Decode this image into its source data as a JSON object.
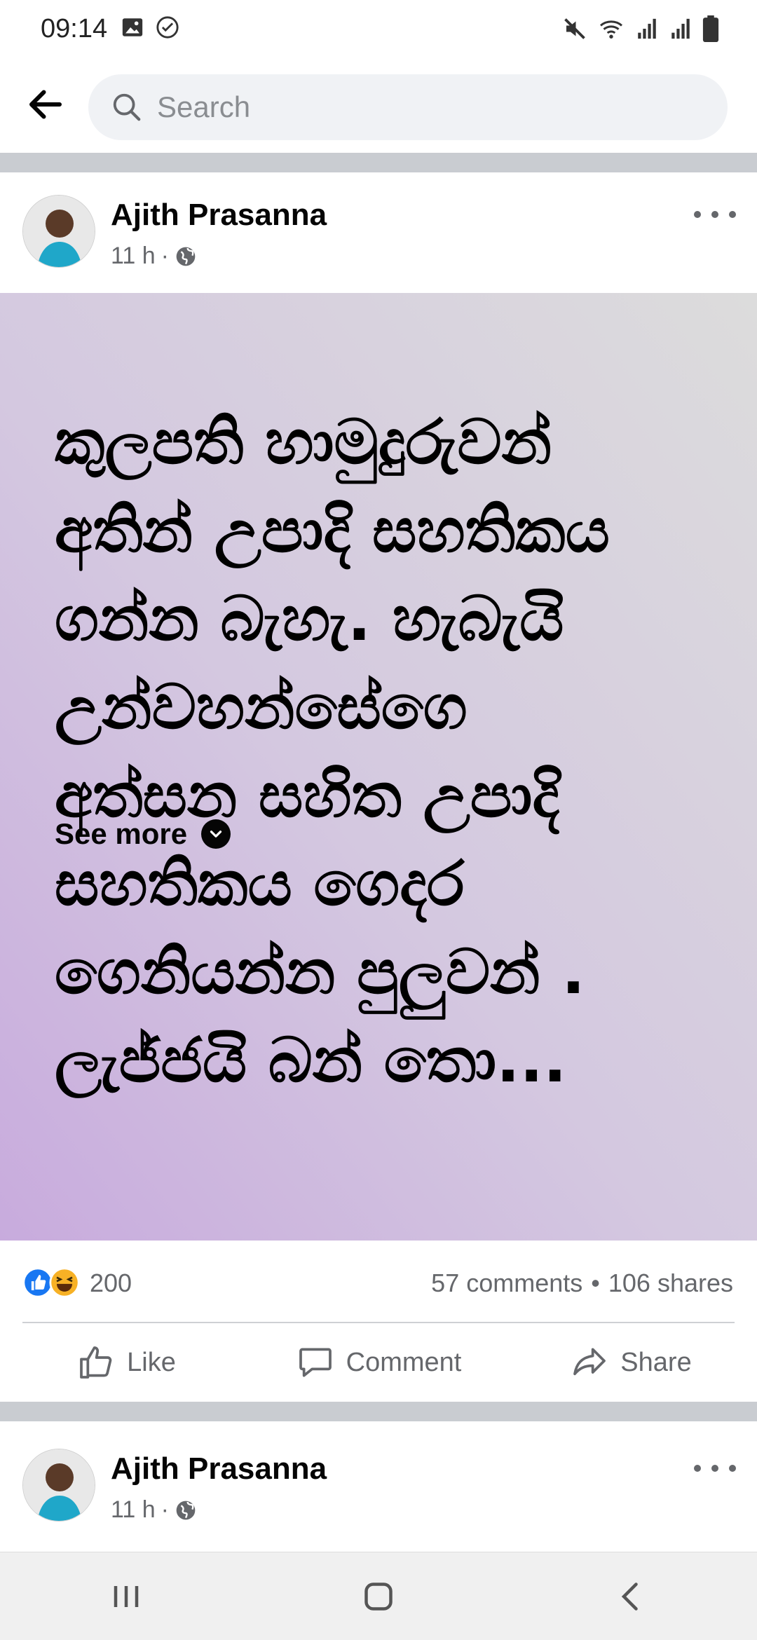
{
  "status_bar": {
    "time": "09:14",
    "icons_left": [
      "gallery-icon",
      "check-circle-icon"
    ],
    "icons_right": [
      "mute-icon",
      "wifi-icon",
      "signal-icon",
      "signal-icon",
      "battery-icon"
    ]
  },
  "search": {
    "placeholder": "Search"
  },
  "post": {
    "author": "Ajith Prasanna",
    "time": "11 h",
    "separator": "·",
    "audience_icon": "globe-icon",
    "text_lines": [
      "කුලපති හාමුදුරුවන්",
      "අතින් උපාදි සහතිකය",
      "ගන්න බැහැ. හැබැයි",
      "උන්වහන්සේගෙ",
      "අත්සන සහිත උපාදි",
      "සහතිකය ගෙදර",
      "ගෙනියන්න පුලුවන් .",
      "ලැජ්ජයි බන් තො..."
    ],
    "see_more": "See more",
    "background_colors": [
      "#c8abdd",
      "#dcdcdc"
    ]
  },
  "reactions": {
    "icons": [
      "like-reaction-icon",
      "haha-reaction-icon"
    ],
    "count": "200",
    "comments": "57 comments",
    "dot": "•",
    "shares": "106 shares"
  },
  "actions": {
    "like": "Like",
    "comment": "Comment",
    "share": "Share"
  },
  "next_post": {
    "author": "Ajith Prasanna",
    "time": "11 h",
    "separator": "·"
  },
  "nav": {
    "buttons": [
      "recent-apps-icon",
      "home-icon",
      "back-icon"
    ]
  },
  "colors": {
    "brand_blue": "#1877f2",
    "haha_yellow": "#f7b125",
    "secondary_text": "#65676b"
  }
}
